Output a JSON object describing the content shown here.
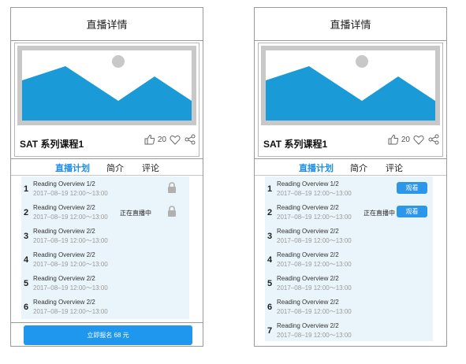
{
  "left": {
    "header": {
      "title": "直播详情"
    },
    "course": {
      "title": "SAT 系列课程1",
      "likes": "20"
    },
    "tabs": [
      {
        "label": "直播计划",
        "active": true
      },
      {
        "label": "简介",
        "active": false
      },
      {
        "label": "评论",
        "active": false
      }
    ],
    "items": [
      {
        "index": "1",
        "title": "Reading Overview 1/2",
        "time": "2017–08–19 12:00～13:00",
        "status": "",
        "action": "lock"
      },
      {
        "index": "2",
        "title": "Reading Overview 2/2",
        "time": "2017–08–19 12:00～13:00",
        "status": "正在直播中",
        "action": "lock"
      },
      {
        "index": "3",
        "title": "Reading Overview 2/2",
        "time": "2017–08–19 12:00～13:00",
        "status": "",
        "action": ""
      },
      {
        "index": "4",
        "title": "Reading Overview 2/2",
        "time": "2017–08–19 12:00～13:00",
        "status": "",
        "action": ""
      },
      {
        "index": "5",
        "title": "Reading Overview 2/2",
        "time": "2017–08–19 12:00～13:00",
        "status": "",
        "action": ""
      },
      {
        "index": "6",
        "title": "Reading Overview 2/2",
        "time": "2017–08–19 12:00～13:00",
        "status": "",
        "action": ""
      }
    ],
    "enroll_label": "立即报名 68 元"
  },
  "right": {
    "header": {
      "title": "直播详情"
    },
    "course": {
      "title": "SAT 系列课程1",
      "likes": "20"
    },
    "tabs": [
      {
        "label": "直播计划",
        "active": true
      },
      {
        "label": "简介",
        "active": false
      },
      {
        "label": "评论",
        "active": false
      }
    ],
    "items": [
      {
        "index": "1",
        "title": "Reading Overview 1/2",
        "time": "2017–08–19 12:00～13:00",
        "status": "",
        "action": "watch"
      },
      {
        "index": "2",
        "title": "Reading Overview 2/2",
        "time": "2017–08–19 12:00～13:00",
        "status": "正在直播中",
        "action": "watch"
      },
      {
        "index": "3",
        "title": "Reading Overview 2/2",
        "time": "2017–08–19 12:00～13:00",
        "status": "",
        "action": ""
      },
      {
        "index": "4",
        "title": "Reading Overview 2/2",
        "time": "2017–08–19 12:00～13:00",
        "status": "",
        "action": ""
      },
      {
        "index": "5",
        "title": "Reading Overview 2/2",
        "time": "2017–08–19 12:00～13:00",
        "status": "",
        "action": ""
      },
      {
        "index": "6",
        "title": "Reading Overview 2/2",
        "time": "2017–08–19 12:00～13:00",
        "status": "",
        "action": ""
      },
      {
        "index": "7",
        "title": "Reading Overview 2/2",
        "time": "2017–08–19 12:00～13:00",
        "status": "",
        "action": ""
      }
    ],
    "watch_label": "观看"
  },
  "icons": {
    "image_placeholder": "image-placeholder-icon",
    "like": "thumbs-up-icon",
    "favorite": "heart-icon",
    "share": "share-icon",
    "lock": "lock-icon"
  },
  "colors": {
    "accent": "#1d8ee6",
    "button": "#1f97ef",
    "list_bg": "#eaf5fb",
    "mountain": "#1a9bd7",
    "muted_text": "#9a9a9a"
  }
}
